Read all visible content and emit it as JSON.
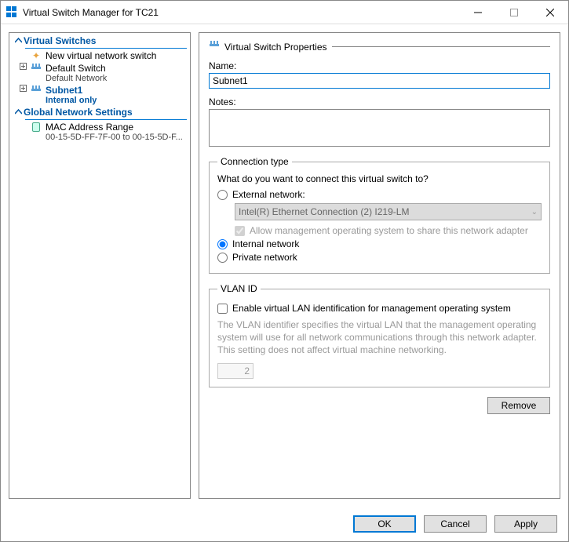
{
  "window": {
    "title": "Virtual Switch Manager for TC21"
  },
  "tree": {
    "section1": "Virtual Switches",
    "new_switch": "New virtual network switch",
    "default_switch": {
      "label": "Default Switch",
      "sub": "Default Network"
    },
    "subnet1": {
      "label": "Subnet1",
      "sub": "Internal only"
    },
    "section2": "Global Network Settings",
    "mac_range": {
      "label": "MAC Address Range",
      "sub": "00-15-5D-FF-7F-00 to 00-15-5D-F..."
    }
  },
  "panel": {
    "section_title": "Virtual Switch Properties",
    "name_label": "Name:",
    "name_value": "Subnet1",
    "notes_label": "Notes:",
    "notes_value": "",
    "conn": {
      "legend": "Connection type",
      "question": "What do you want to connect this virtual switch to?",
      "external_label": "External network:",
      "adapter": "Intel(R) Ethernet Connection (2) I219-LM",
      "allow_mgmt": "Allow management operating system to share this network adapter",
      "internal_label": "Internal network",
      "private_label": "Private network"
    },
    "vlan": {
      "legend": "VLAN ID",
      "enable_label": "Enable virtual LAN identification for management operating system",
      "help": "The VLAN identifier specifies the virtual LAN that the management operating system will use for all network communications through this network adapter. This setting does not affect virtual machine networking.",
      "value": "2"
    },
    "remove": "Remove"
  },
  "buttons": {
    "ok": "OK",
    "cancel": "Cancel",
    "apply": "Apply"
  }
}
